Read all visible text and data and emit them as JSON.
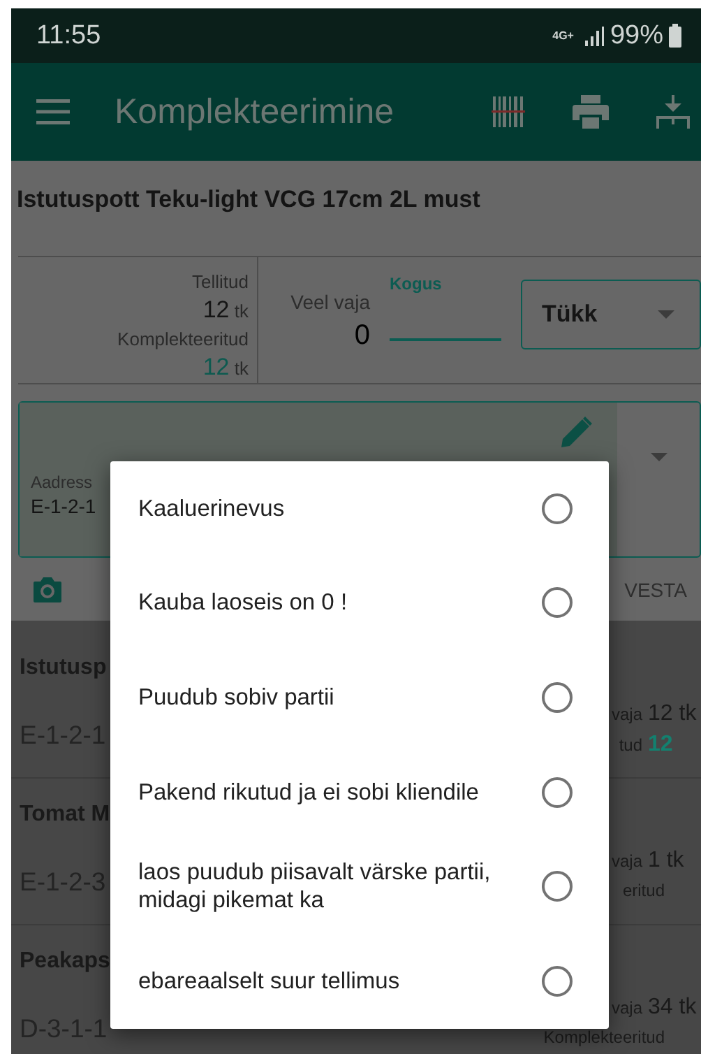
{
  "status_bar": {
    "time": "11:55",
    "network": "4G+",
    "battery": "99%"
  },
  "app_bar": {
    "title": "Komplekteerimine"
  },
  "product": {
    "title": "Istutuspott Teku-light VCG 17cm 2L must",
    "ordered_label": "Tellitud",
    "ordered_value": "12",
    "ordered_unit": "tk",
    "picked_label": "Komplekteeritud",
    "picked_value": "12",
    "picked_unit": "tk",
    "remaining_label": "Veel vaja",
    "remaining_value": "0",
    "quantity_label": "Kogus",
    "unit_select": "Tükk"
  },
  "address": {
    "label": "Aadress",
    "value": "E-1-2-1"
  },
  "save_button": "VESTA",
  "list_rows": [
    {
      "title": "Istutusp",
      "location": "E-1-2-1",
      "line_1_label": "vaja",
      "line_1_value": "12 tk",
      "line_2_label": "tud",
      "line_2_value": "12"
    },
    {
      "title": "Tomat M",
      "location": "E-1-2-3",
      "line_1_label": "vaja",
      "line_1_value": "1 tk",
      "line_2_label": "eritud"
    },
    {
      "title": "Peakaps",
      "location": "D-3-1-1",
      "line_1_label": "vaja",
      "line_1_value": "34 tk",
      "line_2_label": "Komplekteeritud"
    }
  ],
  "dialog": {
    "options": [
      {
        "label": "Kaaluerinevus",
        "selected": false
      },
      {
        "label": "Kauba laoseis on 0 !",
        "selected": false
      },
      {
        "label": "Puudub sobiv partii",
        "selected": false
      },
      {
        "label": "Pakend rikutud ja ei sobi kliendile",
        "selected": false
      },
      {
        "label": "laos puudub piisavalt värske partii, midagi pikemat ka",
        "selected": false
      },
      {
        "label": "ebareaalselt suur tellimus",
        "selected": false
      }
    ]
  }
}
